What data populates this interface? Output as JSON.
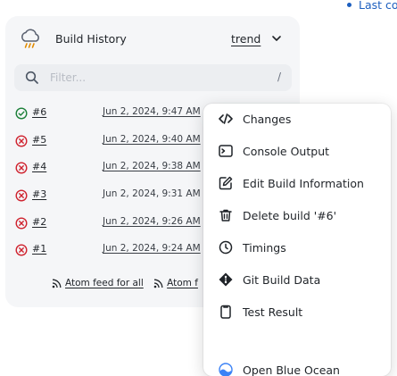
{
  "top_link": {
    "text": "Last co"
  },
  "header": {
    "title": "Build History",
    "trend_label": "trend"
  },
  "filter": {
    "placeholder": "Filter...",
    "shortcut": "/"
  },
  "builds": [
    {
      "number": "#6",
      "date": "Jun 2, 2024, 9:47 AM",
      "status": "success"
    },
    {
      "number": "#5",
      "date": "Jun 2, 2024, 9:40 AM",
      "status": "failed"
    },
    {
      "number": "#4",
      "date": "Jun 2, 2024, 9:38 AM",
      "status": "failed"
    },
    {
      "number": "#3",
      "date": "Jun 2, 2024, 9:31 AM",
      "status": "failed"
    },
    {
      "number": "#2",
      "date": "Jun 2, 2024, 9:26 AM",
      "status": "failed"
    },
    {
      "number": "#1",
      "date": "Jun 2, 2024, 9:24 AM",
      "status": "failed"
    }
  ],
  "feeds": {
    "all_label": "Atom feed for all",
    "failures_label": "Atom f"
  },
  "menu": {
    "items": [
      {
        "label": "Changes",
        "icon": "code-icon"
      },
      {
        "label": "Console Output",
        "icon": "terminal-icon"
      },
      {
        "label": "Edit Build Information",
        "icon": "edit-icon"
      },
      {
        "label": "Delete build '#6'",
        "icon": "trash-icon"
      },
      {
        "label": "Timings",
        "icon": "stopwatch-icon"
      },
      {
        "label": "Git Build Data",
        "icon": "git-icon"
      },
      {
        "label": "Test Result",
        "icon": "clipboard-icon"
      },
      {
        "label": "Open Blue Ocean",
        "icon": "blue-ocean-icon"
      }
    ]
  },
  "colors": {
    "success": "#1a7f37",
    "failed": "#cf222e",
    "link": "#1d5fbf",
    "panel_bg": "#f5f6f8",
    "ocean_blue": "#3b82f6"
  }
}
